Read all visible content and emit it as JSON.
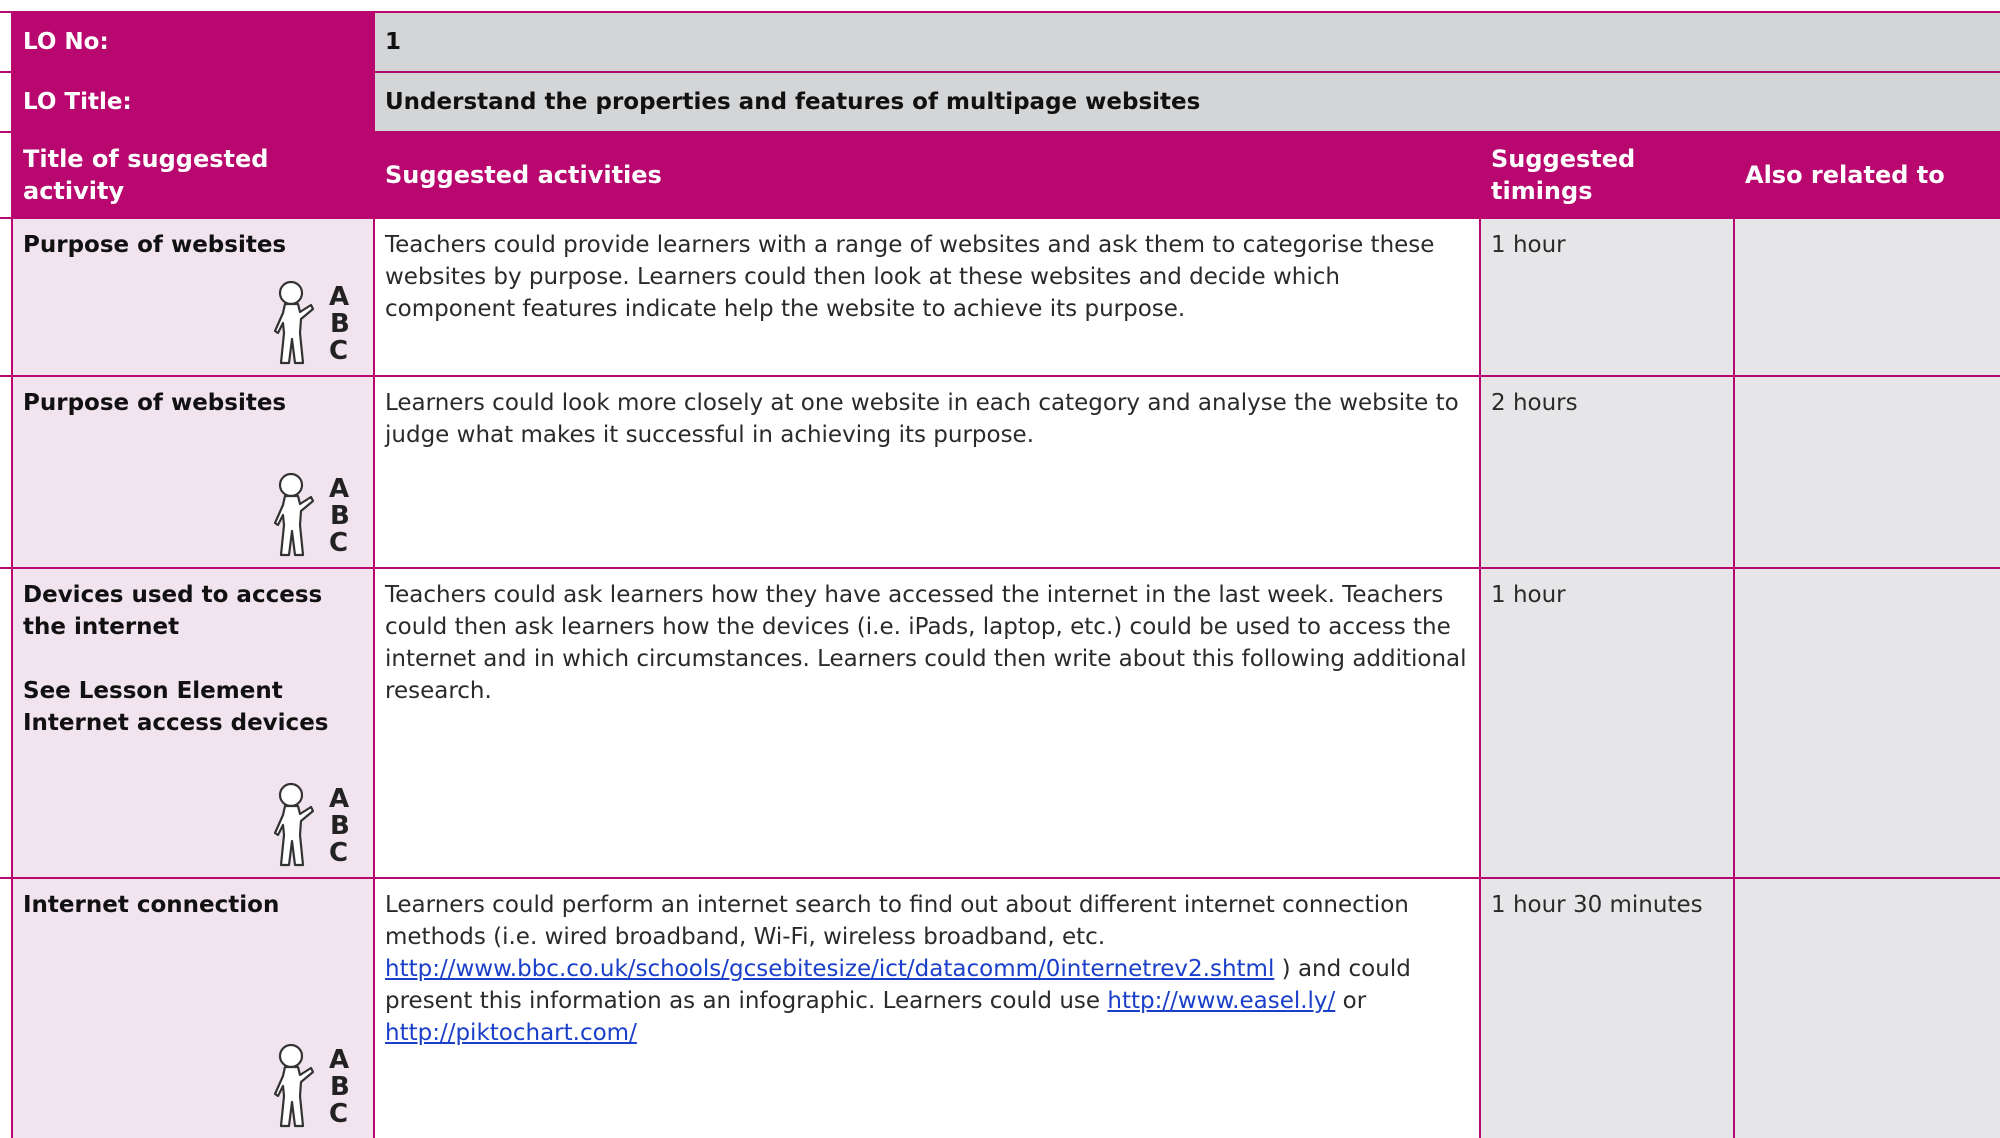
{
  "lo": {
    "no_label": "LO No:",
    "no_value": "1",
    "title_label": "LO Title:",
    "title_value": "Understand the properties and features of multipage websites"
  },
  "headers": {
    "title": "Title of suggested activity",
    "activities": "Suggested activities",
    "timings": "Suggested timings",
    "related": "Also related to"
  },
  "icons": {
    "activity_icon": "learner-abc-icon"
  },
  "rows": [
    {
      "title": "Purpose of websites",
      "activity": "Teachers could provide learners with a range of websites and ask them to categorise these websites by purpose. Learners could then look at these websites and decide which component features indicate help the website to achieve its purpose.",
      "timing": "1 hour"
    },
    {
      "title": "Purpose of websites",
      "activity": "Learners could look more closely at one website in each category and analyse the website to judge what makes it successful in achieving its purpose.",
      "timing": "2 hours"
    },
    {
      "title": "Devices used to access the internet",
      "note": "See Lesson Element Internet access devices",
      "activity": "Teachers could ask learners how they have accessed the internet in the last week. Teachers could then ask learners how the devices (i.e. iPads, laptop, etc.) could be used to access the internet and in which circumstances. Learners could then write about this following additional research.",
      "timing": "1 hour"
    },
    {
      "title": "Internet connection",
      "activity_part1": "Learners could perform an internet search to find out about different internet connection methods (i.e. wired broadband, Wi-Fi, wireless broadband, etc. ",
      "link1": "http://www.bbc.co.uk/schools/gcsebitesize/ict/datacomm/0internetrev2.shtml",
      "activity_part2": " ) and could present this information as an infographic. Learners could use ",
      "link2": "http://www.easel.ly/",
      "activity_part3": " or ",
      "link3": "http://piktochart.com/",
      "timing": "1 hour 30 minutes"
    }
  ]
}
